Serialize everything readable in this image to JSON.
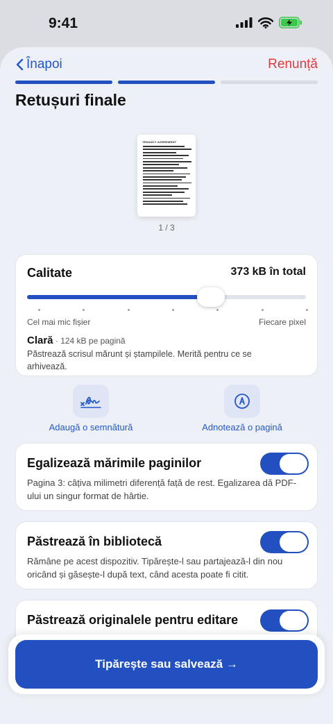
{
  "status": {
    "time": "9:41"
  },
  "nav": {
    "back_label": "Înapoi",
    "cancel_label": "Renunță",
    "steps_total": 3,
    "steps_done": 2
  },
  "title": "Retușuri finale",
  "preview": {
    "doc_heading": "TENANCY AGREEMENT",
    "page_indicator": "1 / 3"
  },
  "quality": {
    "label": "Calitate",
    "total": "373 kB în total",
    "slider_fraction": 0.66,
    "min_label": "Cel mai mic fișier",
    "max_label": "Fiecare pixel",
    "preset_name": "Clară",
    "preset_size": " · 124 kB pe pagină",
    "preset_desc": "Păstrează scrisul mărunt și ștampilele. Merită pentru ce se arhivează."
  },
  "actions": [
    {
      "label": "Adaugă o semnătură",
      "icon": "signature-icon"
    },
    {
      "label": "Adnotează o pagină",
      "icon": "markup-pen-icon"
    }
  ],
  "toggles": [
    {
      "title": "Egalizează mărimile paginilor",
      "desc": "Pagina 3: câțiva milimetri diferență față de rest. Egalizarea dă PDF-ului un singur format de hârtie.",
      "on": true
    },
    {
      "title": "Păstrează în bibliotecă",
      "desc": "Rămâne pe acest dispozitiv. Tipărește-l sau partajează-l din nou oricând și găsește-l după text, când acesta poate fi citit.",
      "on": true
    },
    {
      "title": "Păstrează originalele pentru editare",
      "desc": "",
      "on": true
    }
  ],
  "cta": {
    "label": "Tipărește sau salvează →"
  },
  "colors": {
    "accent": "#2250c0",
    "danger": "#e5383b",
    "link": "#2357c9",
    "battery": "#3cc84a"
  }
}
